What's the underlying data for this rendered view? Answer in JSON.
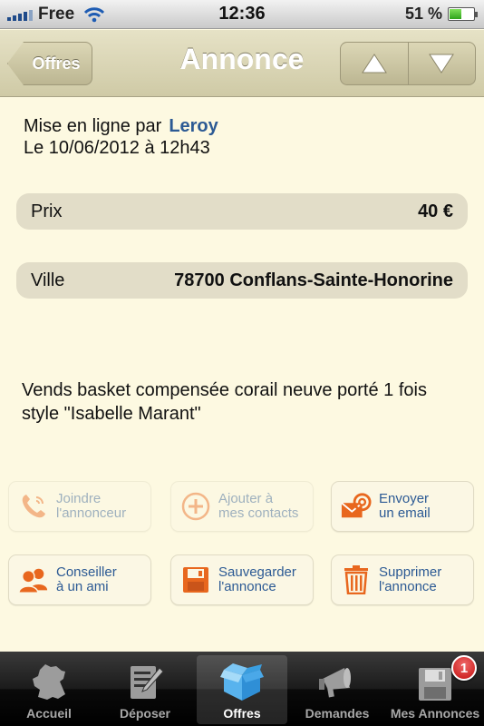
{
  "status": {
    "carrier": "Free",
    "time": "12:36",
    "battery_percent": "51 %",
    "battery_level": 0.51
  },
  "navbar": {
    "back_label": "Offres",
    "title": "Annonce",
    "prev_icon": "triangle-up-icon",
    "next_icon": "triangle-down-icon"
  },
  "listing": {
    "posted_by_label": "Mise en ligne par",
    "author": "Leroy",
    "date": "Le 10/06/2012 à 12h43",
    "price_label": "Prix",
    "price_value": "40 €",
    "city_label": "Ville",
    "city_value": "78700 Conflans-Sainte-Honorine",
    "description_line1": "Vends basket compensée corail neuve porté 1 fois",
    "description_line2": "style \"Isabelle Marant\""
  },
  "actions": [
    {
      "line1": "Joindre",
      "line2": "l'annonceur",
      "icon": "phone-icon",
      "enabled": false
    },
    {
      "line1": "Ajouter à",
      "line2": "mes contacts",
      "icon": "add-contact-icon",
      "enabled": false
    },
    {
      "line1": "Envoyer",
      "line2": "un email",
      "icon": "email-icon",
      "enabled": true
    },
    {
      "line1": "Conseiller",
      "line2": "à un ami",
      "icon": "friends-icon",
      "enabled": true
    },
    {
      "line1": "Sauvegarder",
      "line2": "l'annonce",
      "icon": "save-icon",
      "enabled": true
    },
    {
      "line1": "Supprimer",
      "line2": "l'annonce",
      "icon": "trash-icon",
      "enabled": true
    }
  ],
  "tabbar": {
    "tabs": [
      {
        "label": "Accueil",
        "icon": "france-map-icon"
      },
      {
        "label": "Déposer",
        "icon": "notepad-pen-icon"
      },
      {
        "label": "Offres",
        "icon": "box-icon",
        "active": true
      },
      {
        "label": "Demandes",
        "icon": "megaphone-icon"
      },
      {
        "label": "Mes Annonces",
        "icon": "floppy-icon",
        "badge": "1"
      }
    ]
  },
  "colors": {
    "background": "#fdf9e1",
    "accent_orange": "#e8671e",
    "link_blue": "#2c5a94"
  }
}
